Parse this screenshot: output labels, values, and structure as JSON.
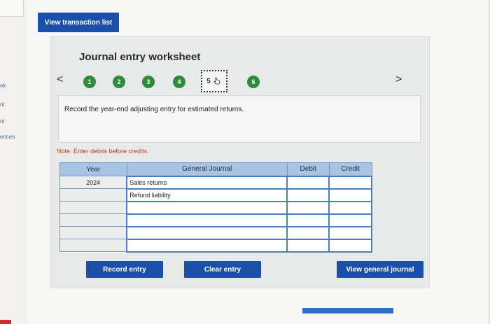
{
  "left_fragments": [
    "ok",
    "nt",
    "nt",
    "ences"
  ],
  "top": {
    "view_transaction_list": "View transaction list"
  },
  "worksheet": {
    "title": "Journal entry worksheet",
    "nav_prev": "<",
    "nav_next": ">",
    "steps": [
      "1",
      "2",
      "3",
      "4",
      "5",
      "6"
    ],
    "current_step": "5",
    "instruction": "Record the year-end adjusting entry for estimated returns.",
    "note": "Note: Enter debits before credits."
  },
  "journal_table": {
    "headers": [
      "Year",
      "General Journal",
      "Debit",
      "Credit"
    ],
    "rows": [
      {
        "year": "2024",
        "account": "Sales returns",
        "debit": "",
        "credit": ""
      },
      {
        "year": "",
        "account": "Refund liability",
        "debit": "",
        "credit": ""
      },
      {
        "year": "",
        "account": "",
        "debit": "",
        "credit": ""
      },
      {
        "year": "",
        "account": "",
        "debit": "",
        "credit": ""
      },
      {
        "year": "",
        "account": "",
        "debit": "",
        "credit": ""
      },
      {
        "year": "",
        "account": "",
        "debit": "",
        "credit": ""
      }
    ]
  },
  "buttons": {
    "record_entry": "Record entry",
    "clear_entry": "Clear entry",
    "view_general_journal": "View general journal"
  },
  "colors": {
    "primary_button": "#1c4fa8",
    "step_green": "#2f8a3e",
    "header_blue": "#a9c3e4",
    "note_red": "#c0392b"
  }
}
